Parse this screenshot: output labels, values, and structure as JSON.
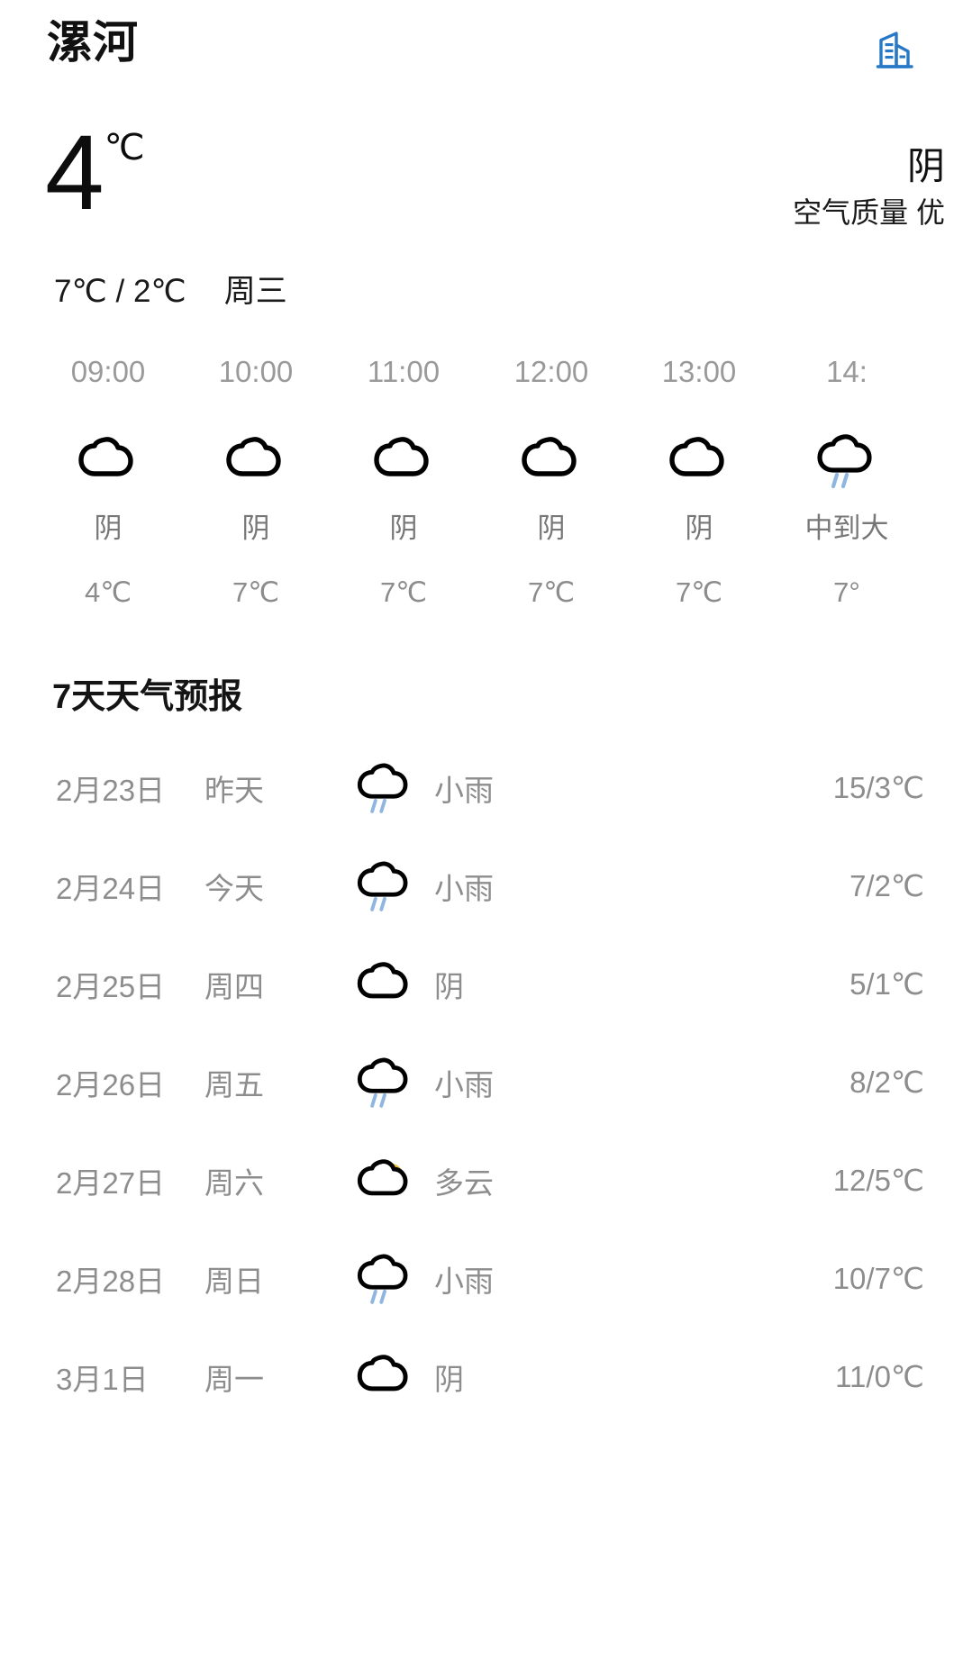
{
  "header": {
    "city": "漯河",
    "city_switch_icon": "building-icon",
    "icon_color": "#2878c8"
  },
  "current": {
    "temperature": "4",
    "temperature_unit": "℃",
    "condition": "阴",
    "air_quality": "空气质量 优",
    "high_low": "7℃ / 2℃",
    "weekday": "周三"
  },
  "hourly": [
    {
      "time": "09:00",
      "icon": "cloud-icon",
      "condition": "阴",
      "temp": "4℃"
    },
    {
      "time": "10:00",
      "icon": "cloud-icon",
      "condition": "阴",
      "temp": "7℃"
    },
    {
      "time": "11:00",
      "icon": "cloud-icon",
      "condition": "阴",
      "temp": "7℃"
    },
    {
      "time": "12:00",
      "icon": "cloud-icon",
      "condition": "阴",
      "temp": "7℃"
    },
    {
      "time": "13:00",
      "icon": "cloud-icon",
      "condition": "阴",
      "temp": "7℃"
    },
    {
      "time": "14:",
      "icon": "rain-cloud-icon",
      "condition": "中到大",
      "temp": "7°"
    }
  ],
  "forecast": {
    "title": "7天天气预报",
    "rows": [
      {
        "date": "2月23日",
        "day": "昨天",
        "icon": "rain-cloud-icon",
        "condition": "小雨",
        "temp": "15/3℃"
      },
      {
        "date": "2月24日",
        "day": "今天",
        "icon": "rain-cloud-icon",
        "condition": "小雨",
        "temp": "7/2℃"
      },
      {
        "date": "2月25日",
        "day": "周四",
        "icon": "cloud-icon",
        "condition": "阴",
        "temp": "5/1℃"
      },
      {
        "date": "2月26日",
        "day": "周五",
        "icon": "rain-cloud-icon",
        "condition": "小雨",
        "temp": "8/2℃"
      },
      {
        "date": "2月27日",
        "day": "周六",
        "icon": "sun-cloud-icon",
        "condition": "多云",
        "temp": "12/5℃"
      },
      {
        "date": "2月28日",
        "day": "周日",
        "icon": "rain-cloud-icon",
        "condition": "小雨",
        "temp": "10/7℃"
      },
      {
        "date": "3月1日",
        "day": "周一",
        "icon": "cloud-icon",
        "condition": "阴",
        "temp": "11/0℃"
      }
    ]
  },
  "colors": {
    "rain_drop": "#8fb6e0",
    "sun": "#f2c33c",
    "icon_outline": "#000000",
    "muted_text": "#8d8d8d"
  }
}
